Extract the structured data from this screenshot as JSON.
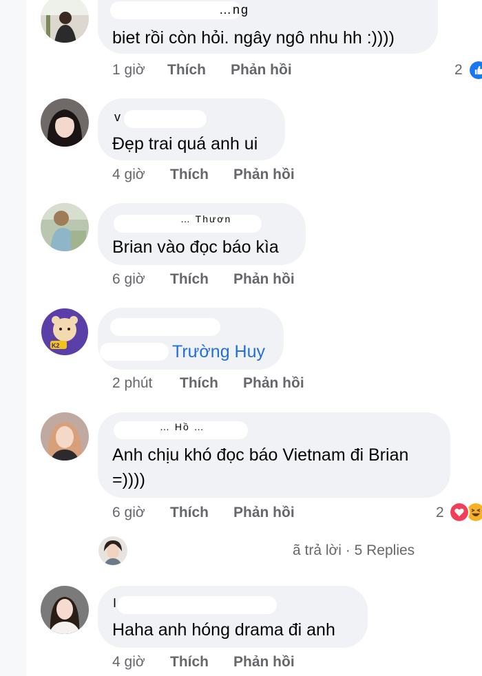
{
  "comments": [
    {
      "name_fragment": "…ng",
      "text": "biet rồi còn hỏi. ngây ngô nhu hh :))))",
      "time": "1 giờ",
      "like": "Thích",
      "reply": "Phản hồi",
      "reaction_count": "2",
      "reaction_icons": [
        "like-icon"
      ]
    },
    {
      "name_fragment": "v",
      "text": "Đẹp trai quá anh ui",
      "time": "4 giờ",
      "like": "Thích",
      "reply": "Phản hồi"
    },
    {
      "name_fragment": "… Thươn",
      "text": "Brian vào đọc báo kìa",
      "time": "6 giờ",
      "like": "Thích",
      "reply": "Phản hồi"
    },
    {
      "mention": "Trường Huy",
      "time": "2 phút",
      "like": "Thích",
      "reply": "Phản hồi"
    },
    {
      "name_fragment": "… Hồ …",
      "text_line1": "Anh chịu khó đọc báo Vietnam đi Brian",
      "text_line2": "=))))",
      "time": "6 giờ",
      "like": "Thích",
      "reply": "Phản hồi",
      "reaction_count": "2",
      "reaction_icons": [
        "love-icon",
        "haha-icon"
      ],
      "replies_summary": "ã trả lời · 5 Replies"
    },
    {
      "name_fragment": "I",
      "text": "Haha anh hóng drama đi anh",
      "time": "4 giờ",
      "like": "Thích",
      "reply": "Phản hồi"
    }
  ],
  "colors": {
    "bubble": "#f0f2f5",
    "meta": "#65676b",
    "mention": "#216fdb",
    "like_blue": "#1877f2",
    "love_red": "#f33e58",
    "haha_yellow": "#f7b125"
  }
}
